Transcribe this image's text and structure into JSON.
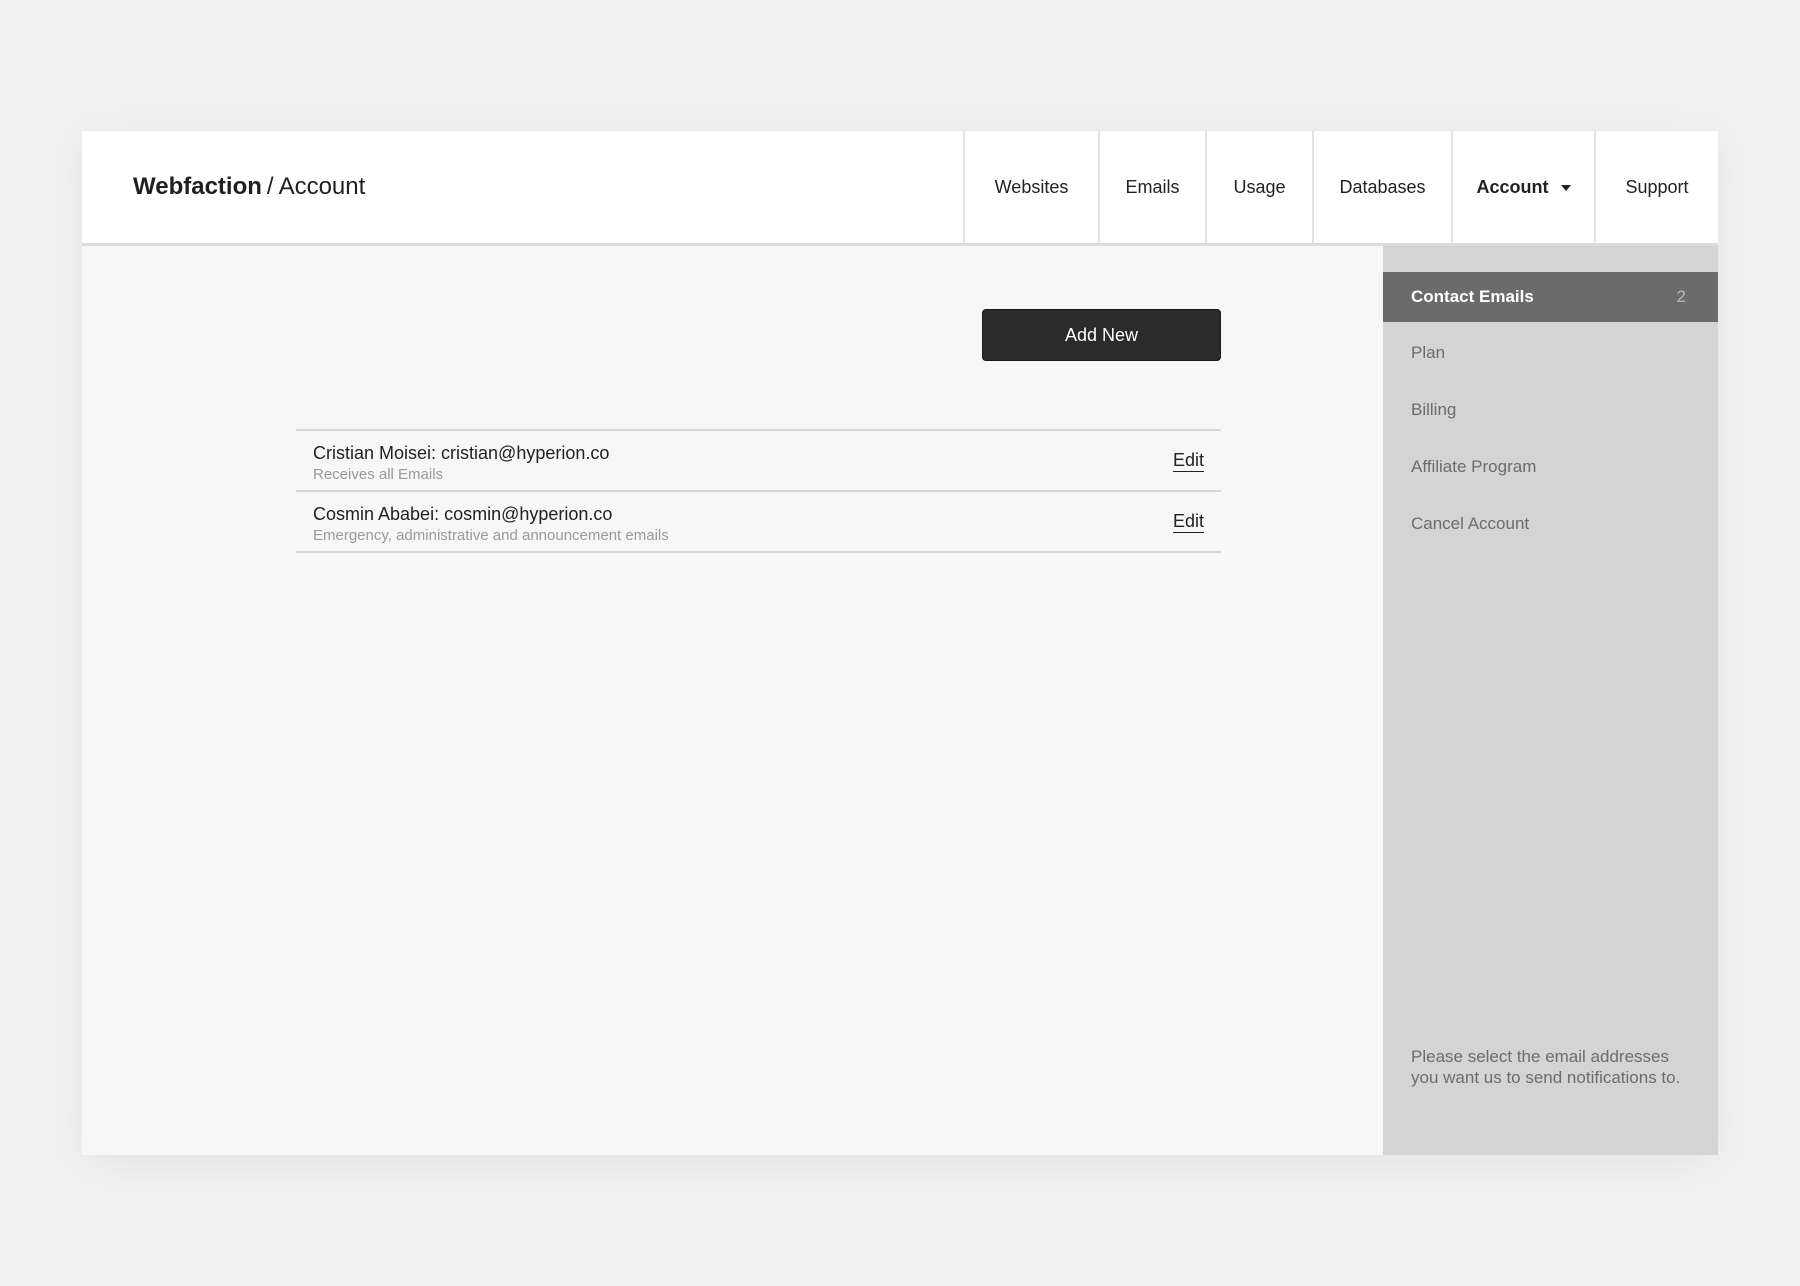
{
  "header": {
    "brand": "Webfaction",
    "separator": "/",
    "section": "Account"
  },
  "nav": {
    "items": [
      {
        "label": "Websites"
      },
      {
        "label": "Emails"
      },
      {
        "label": "Usage"
      },
      {
        "label": "Databases"
      },
      {
        "label": "Account",
        "active": true,
        "has_dropdown": true
      },
      {
        "label": "Support"
      }
    ]
  },
  "main": {
    "add_button_label": "Add New",
    "emails": [
      {
        "title": "Cristian Moisei: cristian@hyperion.co",
        "description": "Receives all Emails",
        "edit_label": "Edit"
      },
      {
        "title": "Cosmin Ababei: cosmin@hyperion.co",
        "description": "Emergency, administrative and announcement emails",
        "edit_label": "Edit"
      }
    ]
  },
  "sidebar": {
    "items": [
      {
        "label": "Contact Emails",
        "count": "2",
        "active": true
      },
      {
        "label": "Plan"
      },
      {
        "label": "Billing"
      },
      {
        "label": "Affiliate Program"
      },
      {
        "label": "Cancel Account"
      }
    ],
    "note": "Please select the email addresses you want us to send notifications to."
  },
  "colors": {
    "page_background": "#f2f2f2",
    "content_background": "#f7f7f7",
    "sidebar_background": "#d4d4d4",
    "sidebar_active": "#6b6b6b",
    "button_background": "#2b2b2b"
  },
  "icons": {
    "account_dropdown": "caret-down-icon"
  }
}
